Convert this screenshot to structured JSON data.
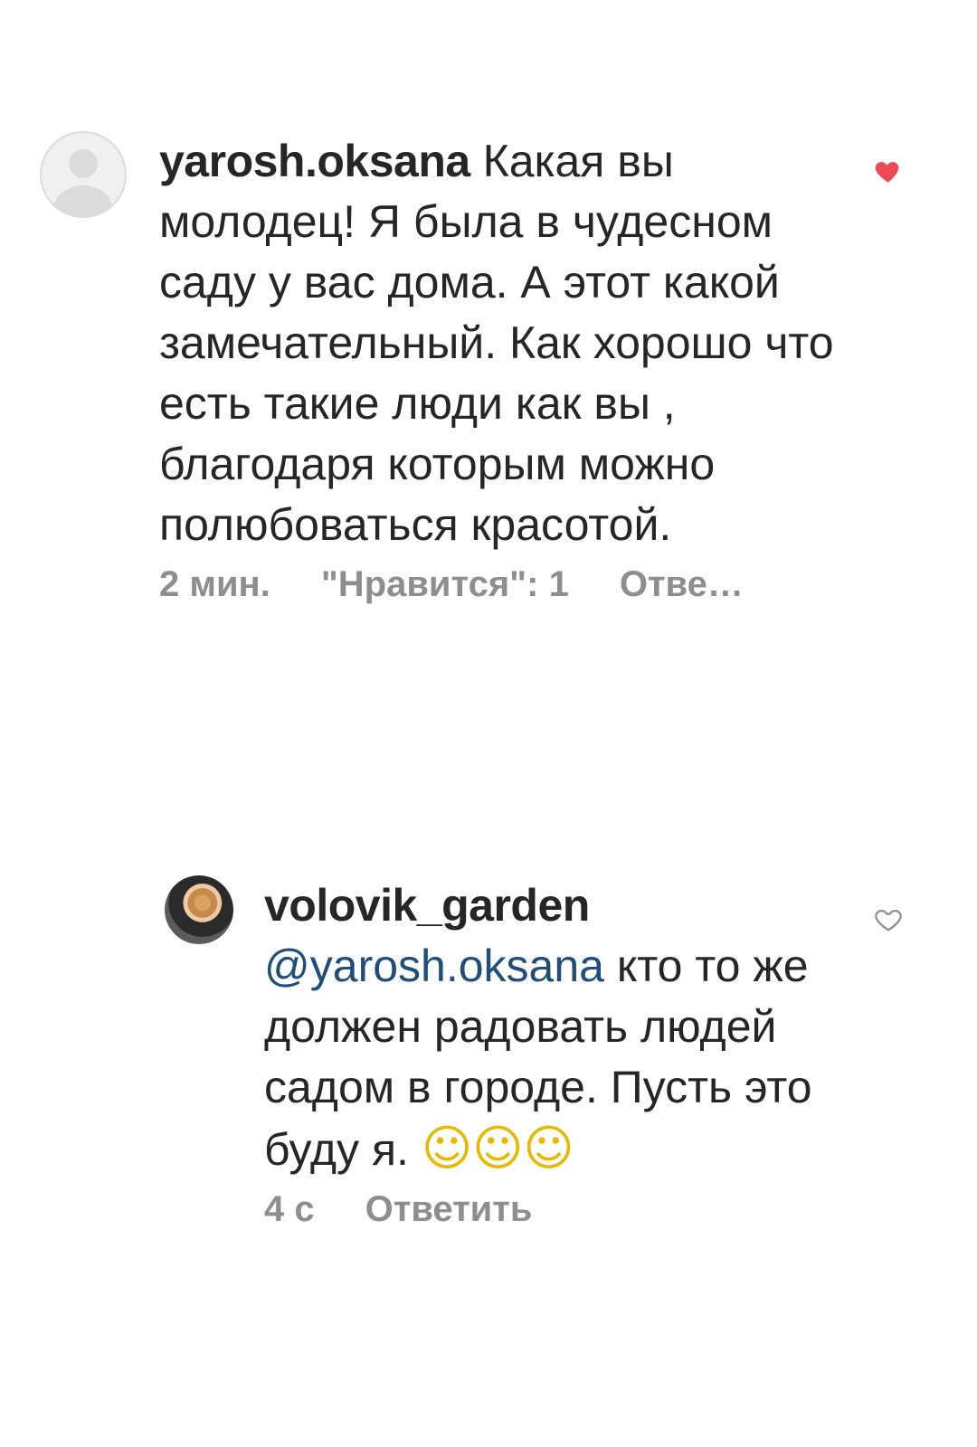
{
  "comments": [
    {
      "username": "yarosh.oksana",
      "text": "Какая вы молодец! Я была в чудесном саду у вас дома. А этот какой замечательный. Как хорошо что есть такие люди как вы , благодаря которым можно полюбоваться красотой.",
      "time": "2 мин.",
      "likes": "\"Нравится\": 1",
      "reply": "Отве…",
      "liked": true,
      "avatar": "default-avatar-icon"
    },
    {
      "username": "volovik_garden",
      "mention": "@yarosh.oksana",
      "text": " кто то же должен радовать людей садом в городе. Пусть это буду я. ",
      "emojis": "☺☺☺",
      "time": "4 с",
      "reply": "Ответить",
      "liked": false,
      "avatar": "profile-photo"
    }
  ],
  "colors": {
    "heart_filled": "#ed4956",
    "heart_outline": "#8e8e8e",
    "mention": "#1f4e7a",
    "meta": "#8e8e8e"
  }
}
